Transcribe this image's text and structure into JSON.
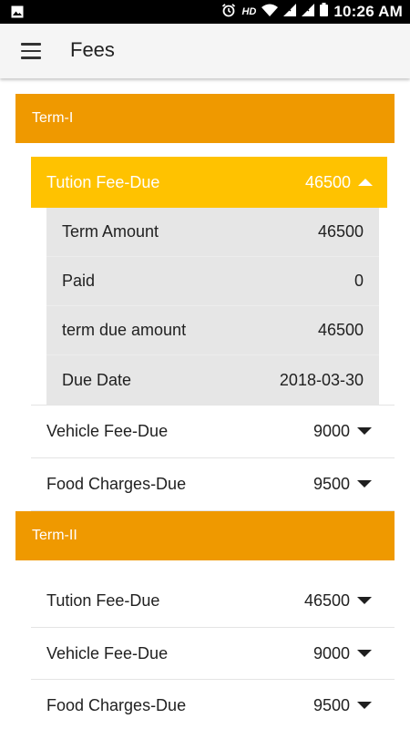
{
  "status_bar": {
    "time": "10:26 AM",
    "hd_label": "HD",
    "icons": [
      "image-icon",
      "alarm-icon",
      "wifi-icon",
      "signal-icon",
      "signal-icon",
      "battery-icon"
    ]
  },
  "app_bar": {
    "title": "Fees",
    "menu_icon": "menu-icon"
  },
  "terms": [
    {
      "label": "Term-I",
      "fees": [
        {
          "label": "Tution Fee-Due",
          "amount": "46500",
          "expanded": true,
          "details": [
            {
              "label": "Term Amount",
              "value": "46500"
            },
            {
              "label": "Paid",
              "value": "0"
            },
            {
              "label": "term due amount",
              "value": "46500"
            },
            {
              "label": "Due Date",
              "value": "2018-03-30"
            }
          ]
        },
        {
          "label": "Vehicle Fee-Due",
          "amount": "9000",
          "expanded": false
        },
        {
          "label": "Food Charges-Due",
          "amount": "9500",
          "expanded": false
        }
      ]
    },
    {
      "label": "Term-II",
      "fees": [
        {
          "label": "Tution Fee-Due",
          "amount": "46500",
          "expanded": false
        },
        {
          "label": "Vehicle Fee-Due",
          "amount": "9000",
          "expanded": false
        },
        {
          "label": "Food Charges-Due",
          "amount": "9500",
          "expanded": false
        }
      ]
    }
  ],
  "colors": {
    "term_header": "#ef9900",
    "expanded_row": "#ffc200",
    "detail_bg": "#e6e6e6",
    "app_bar": "#f5f5f5"
  }
}
